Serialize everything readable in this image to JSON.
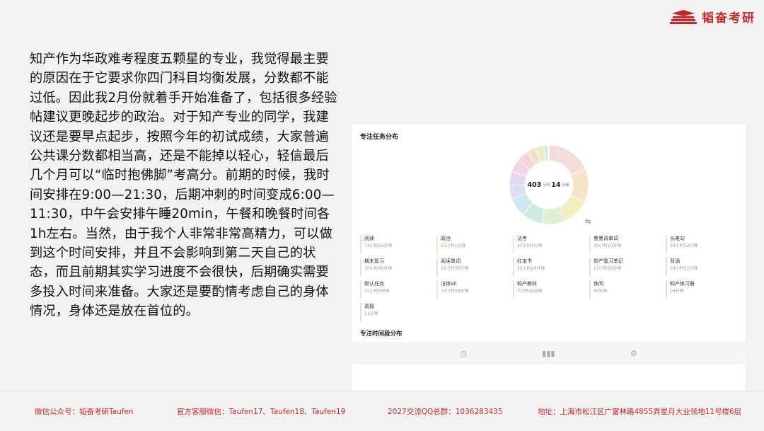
{
  "brand": {
    "name": "韬奋考研"
  },
  "article": {
    "text": "知产作为华政难考程度五颗星的专业，我觉得最主要的原因在于它要求你四门科目均衡发展，分数都不能过低。因此我2月份就着手开始准备了，包括很多经验帖建议更晚起步的政治。对于知产专业的同学，我建议还是要早点起步，按照今年的初试成绩，大家普遍公共课分数都相当高，还是不能掉以轻心，轻信最后几个月可以“临时抱佛脚”考高分。前期的时候，我时间安排在9:00—21:30，后期冲刺的时间变成6:00—11:30，中午会安排午睡20min，午餐和晚餐时间各1h左右。当然，由于我个人非常非常高精力，可以做到这个时间安排，并且不会影响到第二天自己的状态，而且前期其实学习进度不会很快，后期确实需要多投入时间来准备。大家还是要酌情考虑自己的身体情况，身体还是放在首位的。"
  },
  "panel": {
    "title": "专注任务分布",
    "total": {
      "hours": "403",
      "hour_unit": "小时",
      "minutes": "14",
      "minute_unit": "分钟"
    },
    "section2_title": "专注时间段分布",
    "tabs": [
      {
        "icon": "clock-icon"
      },
      {
        "icon": "bar-chart-icon"
      },
      {
        "icon": "gear-icon"
      }
    ]
  },
  "chart_data": {
    "type": "pie",
    "title": "专注任务分布",
    "categories": [
      "阅读",
      "政治",
      "法考",
      "墨墨背单词",
      "长难句",
      "期末复习",
      "阅读单词",
      "红宝书",
      "知产复习笔记",
      "背诵",
      "默认任务",
      "法综all",
      "知产教材",
      "休闲",
      "知产练习册",
      "真题"
    ],
    "values": [
      4463,
      3301,
      2701,
      2350,
      2072,
      1846,
      1376,
      1344,
      1289,
      1195,
      903,
      838,
      444,
      49,
      26,
      11
    ],
    "labels": [
      "74小时23分钟",
      "55小时1分钟",
      "45小时1分钟",
      "39小时10分钟",
      "34小时32分钟",
      "30小时46分钟",
      "22小时56分钟",
      "22小时24分钟",
      "21小时29分钟",
      "19小时55分钟",
      "15小时3分钟",
      "13小时58分钟",
      "7小时24分钟",
      "49分钟",
      "26分钟",
      "11分钟"
    ],
    "colors": [
      "#f3dcdc",
      "#f6e3c8",
      "#f2efc2",
      "#dff0d2",
      "#cfeadf",
      "#cfe7ee",
      "#d8e0f2",
      "#e2d8f0",
      "#eed8e6",
      "#f5d6d6",
      "#f1e2cf",
      "#e9efc9",
      "#d6ecd9",
      "#d3e6ef",
      "#dcd6ee",
      "#ead6e9"
    ]
  },
  "footer": {
    "wechat": "微信公众号：韬奋考研Taufen",
    "service": "官方客服微信：Taufen17、Taufen18、Taufen19",
    "qq": "2027交流QQ总群：1036283435",
    "address": "地址：上海市松江区广富林路4855弄星月大业领地11号楼6层"
  }
}
